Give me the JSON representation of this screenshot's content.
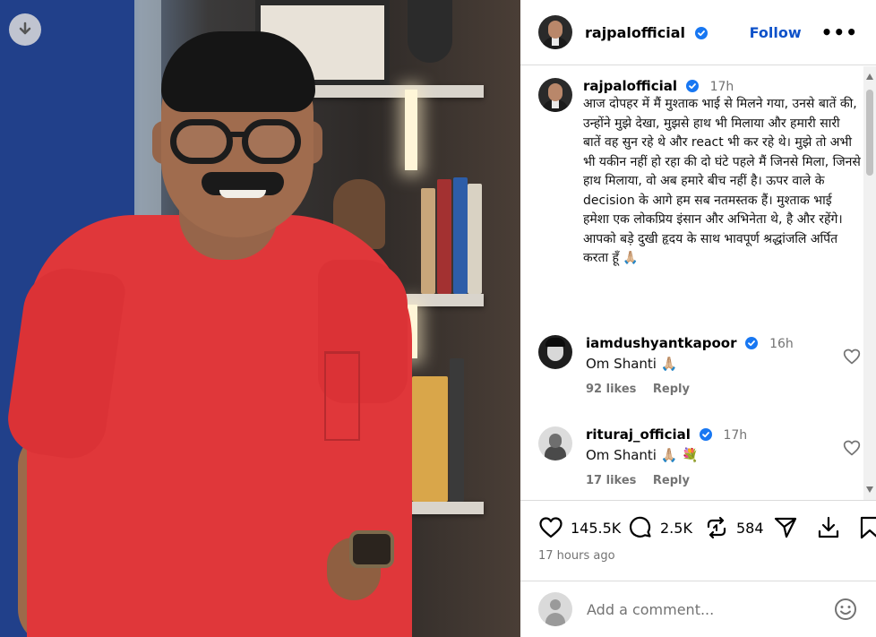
{
  "post": {
    "username": "rajpalofficial",
    "follow_label": "Follow",
    "more_label": "•••",
    "caption_time": "17h",
    "caption_text": "आज दोपहर में मैं मुश्ताक भाई से मिलने गया, उनसे बातें की, उन्होंने मुझे देखा, मुझसे हाथ भी मिलाया और हमारी सारी बातें वह सुन रहे थे और react भी कर रहे थे। मुझे तो अभी भी यकीन नहीं हो रहा की दो घंटे पहले मैं जिनसे मिला, जिनसे हाथ मिलाया, वो अब हमारे बीच नहीं है। ऊपर वाले के decision के आगे हम सब नतमस्तक हैं। मुश्ताक भाई हमेशा एक लोकप्रिय इंसान और अभिनेता थे, है और रहेंगे। आपको बड़े दुखी हृदय के साथ भावपूर्ण श्रद्धांजलि अर्पित करता हूँ 🙏🏼"
  },
  "comments": [
    {
      "username": "iamdushyantkapoor",
      "time": "16h",
      "text": "Om Shanti 🙏🏼",
      "likes": "92 likes",
      "reply": "Reply"
    },
    {
      "username": "rituraj_official",
      "time": "17h",
      "text": "Om Shanti 🙏🏼 💐",
      "likes": "17 likes",
      "reply": "Reply"
    }
  ],
  "stats": {
    "likes": "145.5K",
    "comments": "2.5K",
    "reposts": "584",
    "posted": "17 hours ago"
  },
  "add_comment": {
    "placeholder": "Add a comment..."
  },
  "icons": [
    "download-icon",
    "verified-badge-icon",
    "heart-icon",
    "comment-icon",
    "repost-icon",
    "share-icon",
    "save-download-icon",
    "bookmark-icon",
    "emoji-icon"
  ],
  "colors": {
    "follow": "#0f52c9",
    "verified": "#1877f2",
    "muted": "#737373",
    "shirt": "#e0373a"
  }
}
